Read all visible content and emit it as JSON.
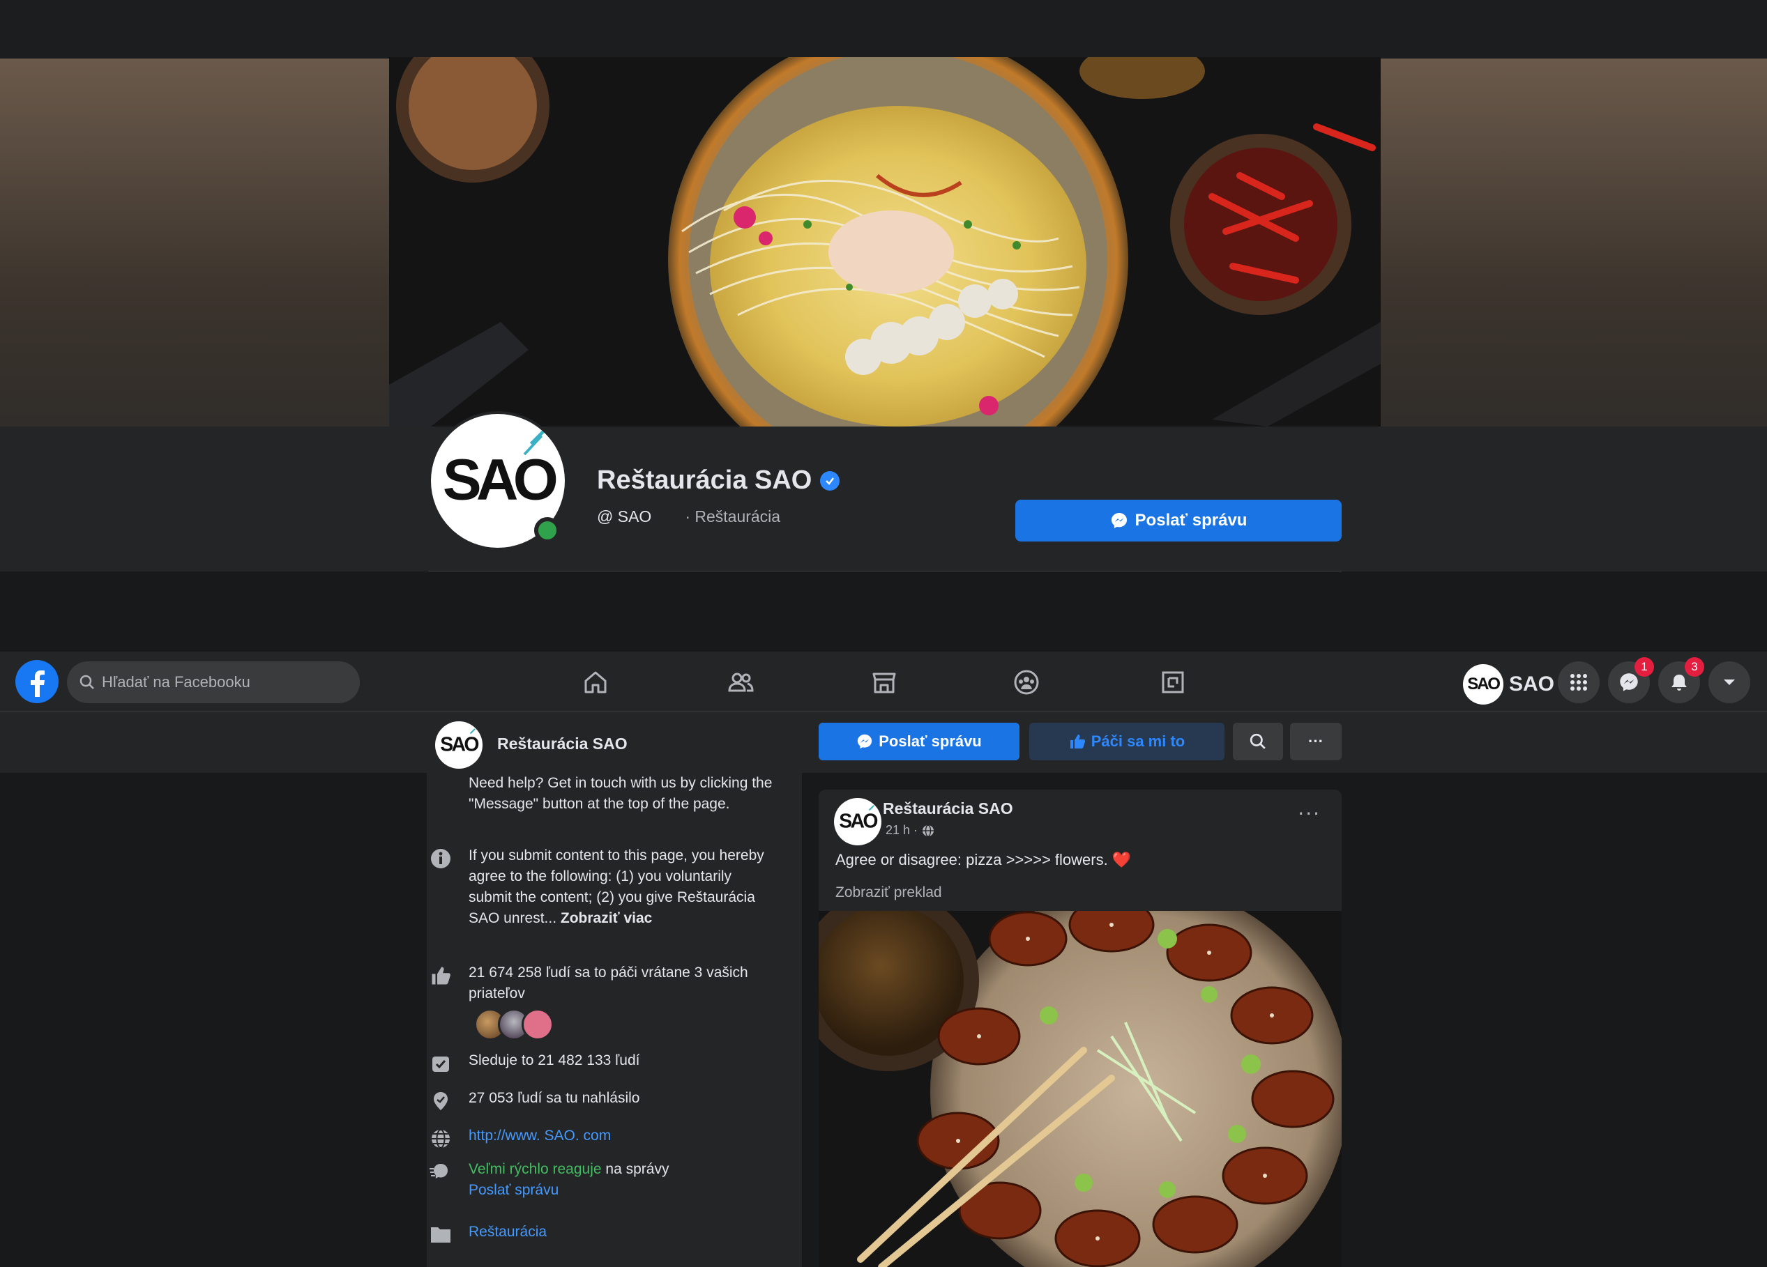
{
  "page": {
    "name": "Reštaurácia SAO",
    "handle": "@ SAO",
    "category": "· Reštaurácia",
    "logo_text": "SAO",
    "send_message": "Poslať správu"
  },
  "nav": {
    "search_placeholder": "Hľadať na Facebooku",
    "brand_label": "SAO",
    "messenger_badge": "1",
    "notifications_badge": "3",
    "icons": [
      "home-icon",
      "friends-icon",
      "marketplace-icon",
      "groups-icon",
      "gaming-icon"
    ]
  },
  "subbar": {
    "name": "Reštaurácia SAO",
    "send_label": "Poslať správu",
    "like_label": "Páči sa mi to",
    "more_label": "···"
  },
  "info": {
    "help_text": "Need help? Get in touch with us by clicking the \"Message\" button at the top of the page.",
    "terms_text": "If you submit content to this page, you hereby agree to the following: (1) you voluntarily submit the content; (2) you give Reštaurácia SAO unrest...",
    "terms_more": "Zobraziť viac",
    "likes_text": "21 674 258 ľudí sa to páči vrátane 3 vašich priateľov",
    "followers_text": "Sleduje to 21 482 133 ľudí",
    "checkins_text": "27 053 ľudí sa tu nahlásilo",
    "website": "http://www. SAO. com",
    "response_fast": "Veľmi rýchlo reaguje",
    "response_rest": " na správy",
    "response_link": "Poslať správu",
    "category_link": "Reštaurácia"
  },
  "post": {
    "author": "Reštaurácia SAO",
    "time": "21 h ·",
    "text": "Agree or disagree: pizza >>>>> flowers.",
    "emoji": "❤️",
    "translate": "Zobraziť preklad",
    "more": "···"
  },
  "colors": {
    "accent": "#1b74e4",
    "link": "#4599ff",
    "background": "#18191a",
    "surface": "#242526",
    "badge": "#e41e3f",
    "online": "#31a24c"
  }
}
